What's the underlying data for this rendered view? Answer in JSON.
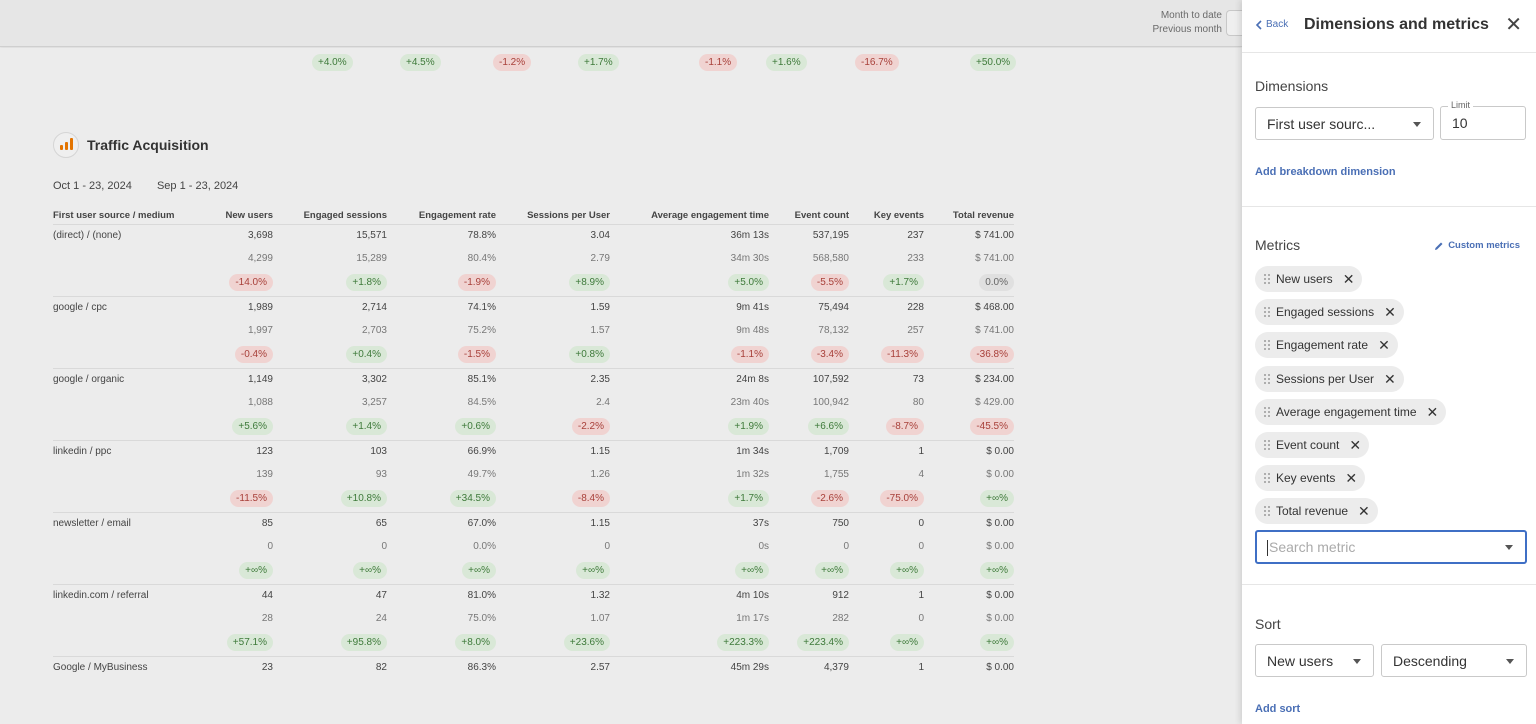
{
  "topbar": {
    "current_period": "Month to date",
    "compare_period": "Previous month"
  },
  "previous_card_deltas": [
    {
      "text": "+4.0%",
      "tone": "pos"
    },
    {
      "text": "+4.5%",
      "tone": "pos"
    },
    {
      "text": "-1.2%",
      "tone": "neg"
    },
    {
      "text": "+1.7%",
      "tone": "pos"
    },
    {
      "text": "-1.1%",
      "tone": "neg"
    },
    {
      "text": "+1.6%",
      "tone": "pos"
    },
    {
      "text": "-16.7%",
      "tone": "neg"
    },
    {
      "text": "+50.0%",
      "tone": "pos"
    }
  ],
  "card": {
    "title": "Traffic Acquisition",
    "period_current": "Oct 1 - 23, 2024",
    "period_previous": "Sep 1 - 23, 2024",
    "columns": [
      "First user source / medium",
      "New users",
      "Engaged sessions",
      "Engagement rate",
      "Sessions per User",
      "Average engagement time",
      "Event count",
      "Key events",
      "Total revenue"
    ],
    "rows": [
      {
        "source": "(direct) / (none)",
        "current": [
          "3,698",
          "15,571",
          "78.8%",
          "3.04",
          "36m 13s",
          "537,195",
          "237",
          "$ 741.00"
        ],
        "previous": [
          "4,299",
          "15,289",
          "80.4%",
          "2.79",
          "34m 30s",
          "568,580",
          "233",
          "$ 741.00"
        ],
        "delta": [
          [
            "-14.0%",
            "neg"
          ],
          [
            "+1.8%",
            "pos"
          ],
          [
            "-1.9%",
            "neg"
          ],
          [
            "+8.9%",
            "pos"
          ],
          [
            "+5.0%",
            "pos"
          ],
          [
            "-5.5%",
            "neg"
          ],
          [
            "+1.7%",
            "pos"
          ],
          [
            "0.0%",
            "neu"
          ]
        ]
      },
      {
        "source": "google / cpc",
        "current": [
          "1,989",
          "2,714",
          "74.1%",
          "1.59",
          "9m 41s",
          "75,494",
          "228",
          "$ 468.00"
        ],
        "previous": [
          "1,997",
          "2,703",
          "75.2%",
          "1.57",
          "9m 48s",
          "78,132",
          "257",
          "$ 741.00"
        ],
        "delta": [
          [
            "-0.4%",
            "neg"
          ],
          [
            "+0.4%",
            "pos"
          ],
          [
            "-1.5%",
            "neg"
          ],
          [
            "+0.8%",
            "pos"
          ],
          [
            "-1.1%",
            "neg"
          ],
          [
            "-3.4%",
            "neg"
          ],
          [
            "-11.3%",
            "neg"
          ],
          [
            "-36.8%",
            "neg"
          ]
        ]
      },
      {
        "source": "google / organic",
        "current": [
          "1,149",
          "3,302",
          "85.1%",
          "2.35",
          "24m 8s",
          "107,592",
          "73",
          "$ 234.00"
        ],
        "previous": [
          "1,088",
          "3,257",
          "84.5%",
          "2.4",
          "23m 40s",
          "100,942",
          "80",
          "$ 429.00"
        ],
        "delta": [
          [
            "+5.6%",
            "pos"
          ],
          [
            "+1.4%",
            "pos"
          ],
          [
            "+0.6%",
            "pos"
          ],
          [
            "-2.2%",
            "neg"
          ],
          [
            "+1.9%",
            "pos"
          ],
          [
            "+6.6%",
            "pos"
          ],
          [
            "-8.7%",
            "neg"
          ],
          [
            "-45.5%",
            "neg"
          ]
        ]
      },
      {
        "source": "linkedin / ppc",
        "current": [
          "123",
          "103",
          "66.9%",
          "1.15",
          "1m 34s",
          "1,709",
          "1",
          "$ 0.00"
        ],
        "previous": [
          "139",
          "93",
          "49.7%",
          "1.26",
          "1m 32s",
          "1,755",
          "4",
          "$ 0.00"
        ],
        "delta": [
          [
            "-11.5%",
            "neg"
          ],
          [
            "+10.8%",
            "pos"
          ],
          [
            "+34.5%",
            "pos"
          ],
          [
            "-8.4%",
            "neg"
          ],
          [
            "+1.7%",
            "pos"
          ],
          [
            "-2.6%",
            "neg"
          ],
          [
            "-75.0%",
            "neg"
          ],
          [
            "+∞%",
            "pos"
          ]
        ]
      },
      {
        "source": "newsletter / email",
        "current": [
          "85",
          "65",
          "67.0%",
          "1.15",
          "37s",
          "750",
          "0",
          "$ 0.00"
        ],
        "previous": [
          "0",
          "0",
          "0.0%",
          "0",
          "0s",
          "0",
          "0",
          "$ 0.00"
        ],
        "delta": [
          [
            "+∞%",
            "pos"
          ],
          [
            "+∞%",
            "pos"
          ],
          [
            "+∞%",
            "pos"
          ],
          [
            "+∞%",
            "pos"
          ],
          [
            "+∞%",
            "pos"
          ],
          [
            "+∞%",
            "pos"
          ],
          [
            "+∞%",
            "pos"
          ],
          [
            "+∞%",
            "pos"
          ]
        ]
      },
      {
        "source": "linkedin.com / referral",
        "current": [
          "44",
          "47",
          "81.0%",
          "1.32",
          "4m 10s",
          "912",
          "1",
          "$ 0.00"
        ],
        "previous": [
          "28",
          "24",
          "75.0%",
          "1.07",
          "1m 17s",
          "282",
          "0",
          "$ 0.00"
        ],
        "delta": [
          [
            "+57.1%",
            "pos"
          ],
          [
            "+95.8%",
            "pos"
          ],
          [
            "+8.0%",
            "pos"
          ],
          [
            "+23.6%",
            "pos"
          ],
          [
            "+223.3%",
            "pos"
          ],
          [
            "+223.4%",
            "pos"
          ],
          [
            "+∞%",
            "pos"
          ],
          [
            "+∞%",
            "pos"
          ]
        ]
      },
      {
        "source": "Google / MyBusiness",
        "current": [
          "23",
          "82",
          "86.3%",
          "2.57",
          "45m 29s",
          "4,379",
          "1",
          "$ 0.00"
        ],
        "previous": [],
        "delta": []
      }
    ]
  },
  "panel": {
    "back_label": "Back",
    "title": "Dimensions and metrics",
    "dimensions_label": "Dimensions",
    "dimension_value": "First user sourc...",
    "limit_label": "Limit",
    "limit_value": "10",
    "add_breakdown": "Add breakdown dimension",
    "metrics_label": "Metrics",
    "custom_metrics": "Custom metrics",
    "metrics": [
      "New users",
      "Engaged sessions",
      "Engagement rate",
      "Sessions per User",
      "Average engagement time",
      "Event count",
      "Key events",
      "Total revenue"
    ],
    "search_placeholder": "Search metric",
    "sort_label": "Sort",
    "sort_field": "New users",
    "sort_order": "Descending",
    "add_sort": "Add sort"
  },
  "colors": {
    "accent": "#4a6fb5",
    "positive_bg": "#d9e8d7",
    "negative_bg": "#f0d3d1",
    "focus_border": "#3f6fc5"
  }
}
